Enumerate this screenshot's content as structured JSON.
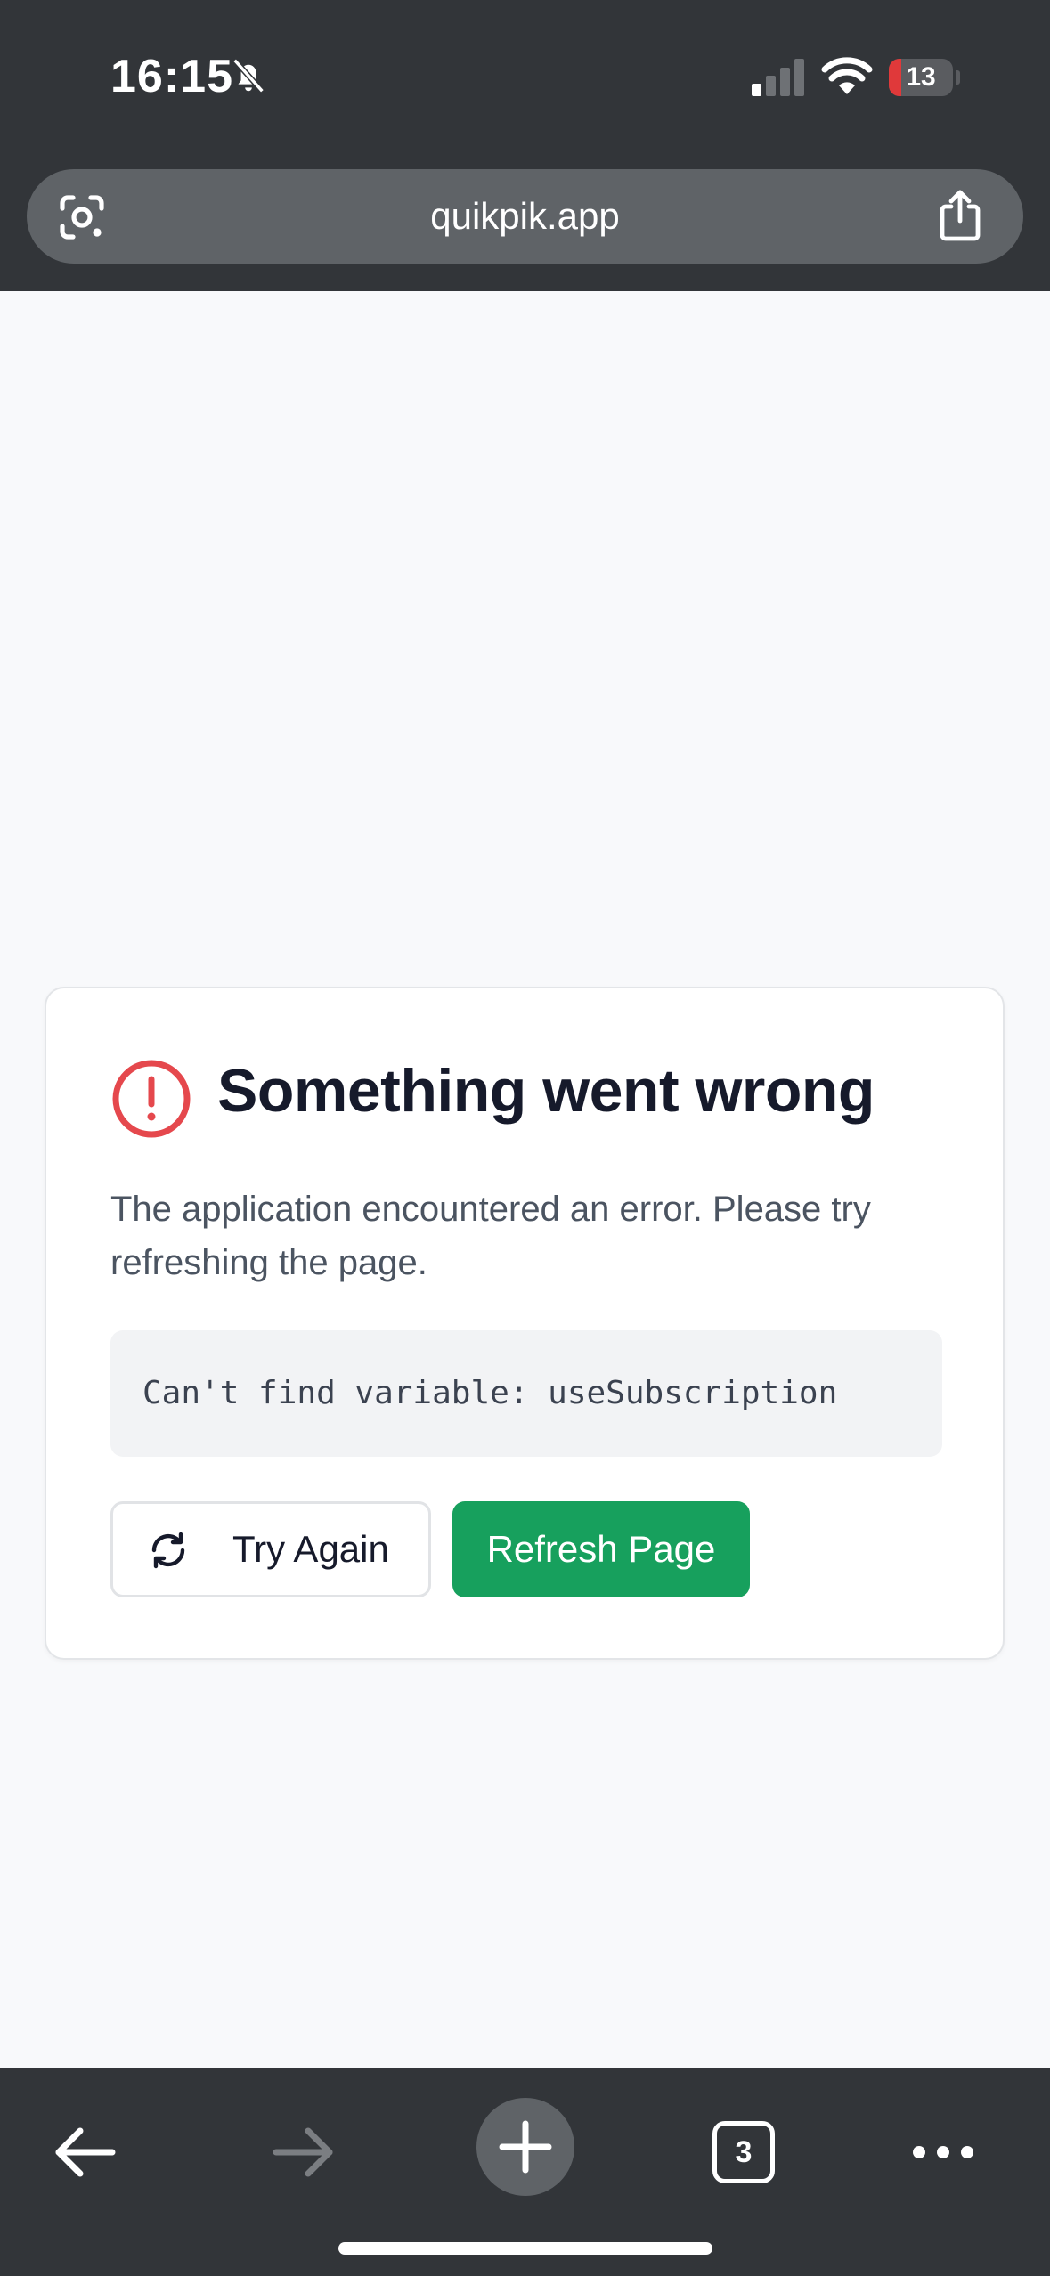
{
  "status_bar": {
    "time": "16:15",
    "battery_level": "13",
    "battery_fraction": 0.13
  },
  "browser": {
    "url": "quikpik.app",
    "tab_count": "3"
  },
  "error_card": {
    "title": "Something went wrong",
    "description": "The application encountered an error. Please try refreshing the page.",
    "error_message": "Can't find variable: useSubscription",
    "try_again_label": "Try Again",
    "refresh_label": "Refresh Page"
  },
  "colors": {
    "chrome_bg": "#323539",
    "urlbar_bg": "#5f6367",
    "page_bg": "#f8f9fb",
    "alert_red": "#e5484d",
    "primary_green": "#17a05d"
  },
  "icons": [
    "mute-bell-icon",
    "cellular-signal-icon",
    "wifi-icon",
    "battery-charging-icon",
    "lens-icon",
    "share-icon",
    "alert-circle-icon",
    "refresh-icon",
    "back-arrow-icon",
    "forward-arrow-icon",
    "plus-icon",
    "more-dots-icon"
  ]
}
